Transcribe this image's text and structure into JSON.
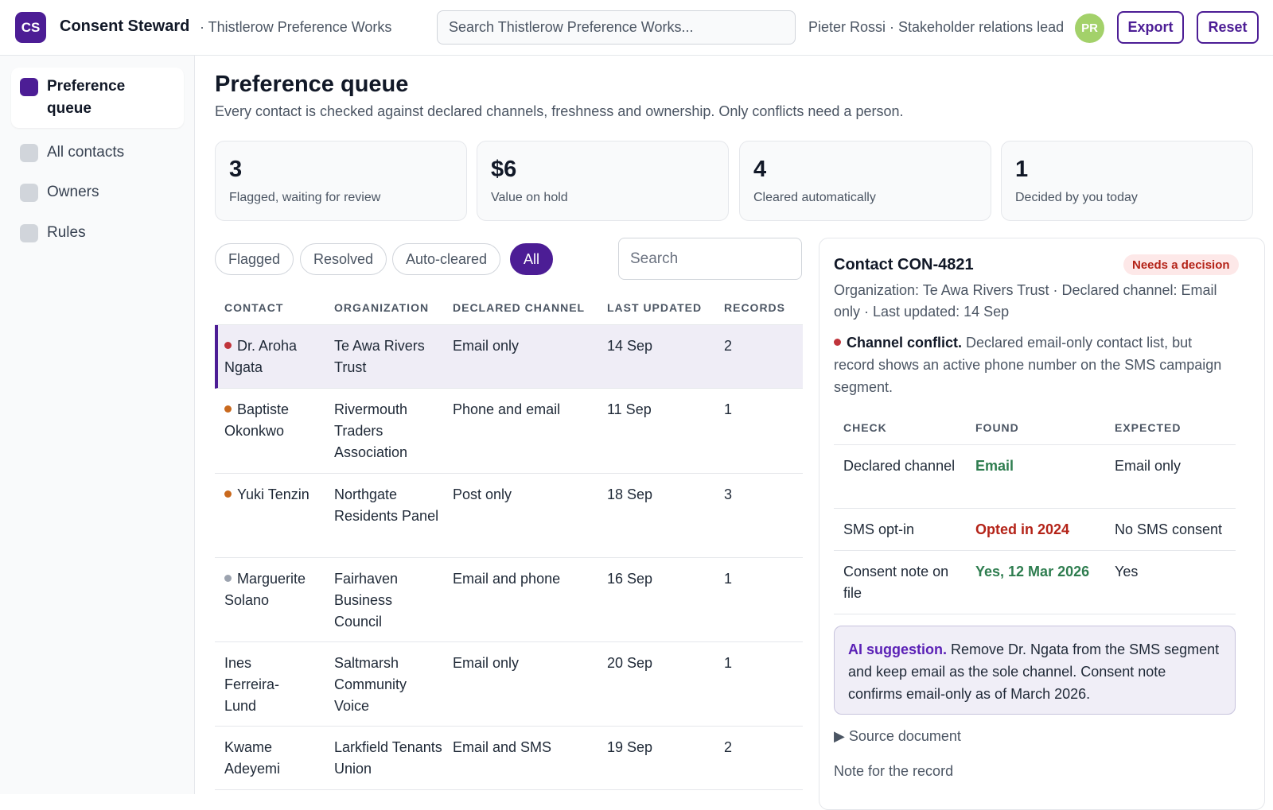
{
  "header": {
    "logo_text": "CS",
    "app_name": "Consent Steward",
    "workspace": "· Thistlerow Preference Works",
    "search_placeholder": "Search Thistlerow Preference Works...",
    "user": "Pieter Rossi · Stakeholder relations lead",
    "avatar_initials": "PR",
    "export_label": "Export",
    "reset_label": "Reset"
  },
  "sidebar": {
    "items": [
      {
        "label": "Preference queue",
        "active": true
      },
      {
        "label": "All contacts",
        "active": false
      },
      {
        "label": "Owners",
        "active": false
      },
      {
        "label": "Rules",
        "active": false
      }
    ]
  },
  "page": {
    "title": "Preference queue",
    "subtitle": "Every contact is checked against declared channels, freshness and ownership. Only conflicts need a person."
  },
  "stats": [
    {
      "value": "3",
      "label": "Flagged, waiting for review"
    },
    {
      "value": "$6",
      "label": "Value on hold"
    },
    {
      "value": "4",
      "label": "Cleared automatically"
    },
    {
      "value": "1",
      "label": "Decided by you today"
    }
  ],
  "filters": {
    "chips": [
      "Flagged",
      "Resolved",
      "Auto-cleared",
      "All"
    ],
    "active": "All",
    "search_placeholder": "Search"
  },
  "table": {
    "headers": [
      "CONTACT",
      "ORGANIZATION",
      "DECLARED CHANNEL",
      "LAST UPDATED",
      "RECORDS"
    ],
    "rows": [
      {
        "contact": "Dr. Aroha Ngata",
        "org": "Te Awa Rivers Trust",
        "channel": "Email only",
        "updated": "14 Sep",
        "records": "2",
        "status_color": "#c0343b",
        "selected": true
      },
      {
        "contact": "Baptiste Okonkwo",
        "org": "Rivermouth Traders Association",
        "channel": "Phone and email",
        "updated": "11 Sep",
        "records": "1",
        "status_color": "#c9691d",
        "selected": false
      },
      {
        "contact": "Yuki Tenzin",
        "org": "Northgate Residents Panel",
        "channel": "Post only",
        "updated": "18 Sep",
        "records": "3",
        "status_color": "#c9691d",
        "selected": false
      },
      {
        "contact": "Marguerite Solano",
        "org": "Fairhaven Business Council",
        "channel": "Email and phone",
        "updated": "16 Sep",
        "records": "1",
        "status_color": "#9ca3af",
        "selected": false
      },
      {
        "contact": "Ines Ferreira-Lund",
        "org": "Saltmarsh Community Voice",
        "channel": "Email only",
        "updated": "20 Sep",
        "records": "1",
        "status_color": "",
        "selected": false
      },
      {
        "contact": "Kwame Adeyemi",
        "org": "Larkfield Tenants Union",
        "channel": "Email and SMS",
        "updated": "19 Sep",
        "records": "2",
        "status_color": "",
        "selected": false
      }
    ]
  },
  "detail": {
    "title": "Contact CON-4821",
    "badge": "Needs a decision",
    "meta": "Organization: Te Awa Rivers Trust · Declared channel: Email only · Last updated: 14 Sep",
    "conflict_title": "Channel conflict.",
    "conflict_text": "Declared email-only contact list, but record shows an active phone number on the SMS campaign segment.",
    "checks_headers": [
      "CHECK",
      "FOUND",
      "EXPECTED"
    ],
    "checks": [
      {
        "check": "Declared channel",
        "found": "Email",
        "found_color": "#2e7d4f",
        "expected": "Email only"
      },
      {
        "check": "SMS opt-in",
        "found": "Opted in 2024",
        "found_color": "#b42318",
        "expected": "No SMS consent"
      },
      {
        "check": "Consent note on file",
        "found": "Yes, 12 Mar 2026",
        "found_color": "#2e7d4f",
        "expected": "Yes"
      }
    ],
    "ai_title": "AI suggestion.",
    "ai_text": "Remove Dr. Ngata from the SMS segment and keep email as the sole channel. Consent note confirms email-only as of March 2026.",
    "source_label": "Source document",
    "note_label": "Note for the record"
  },
  "colors": {
    "accent": "#4c1d95",
    "conflict_red": "#c0343b"
  }
}
